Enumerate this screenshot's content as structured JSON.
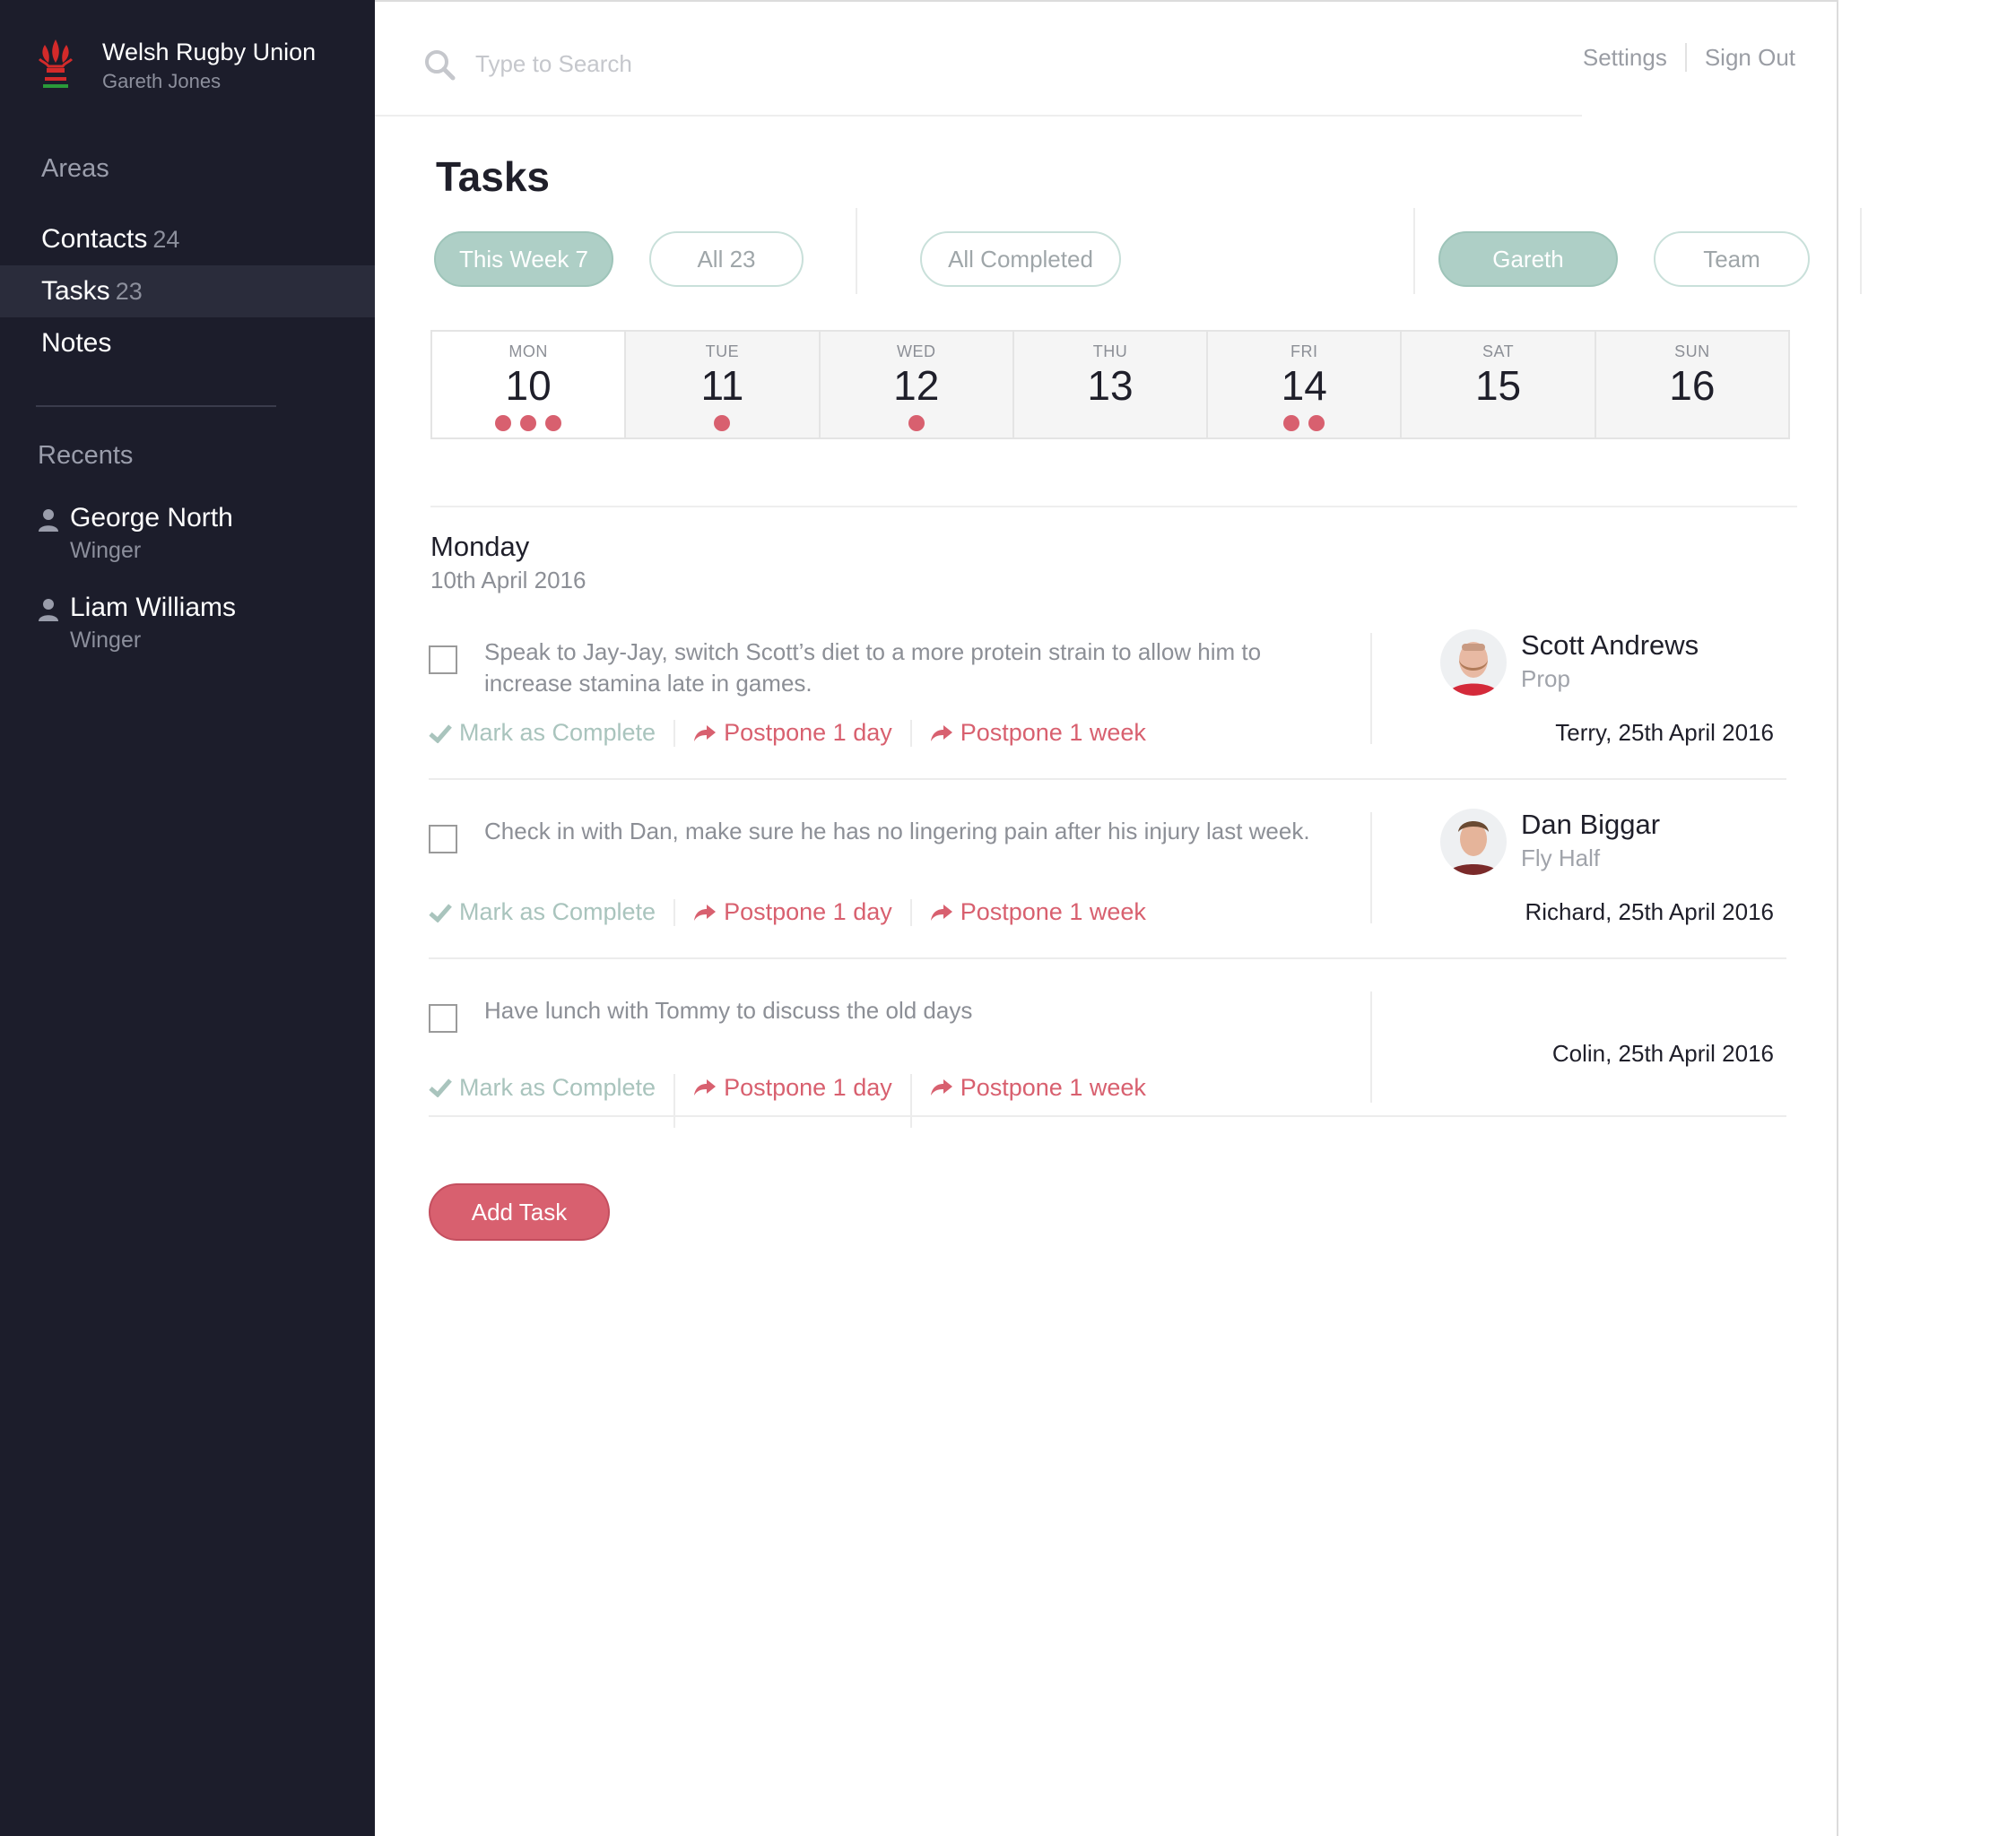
{
  "brand": {
    "title": "Welsh Rugby Union",
    "user": "Gareth Jones"
  },
  "sidebar": {
    "areas_heading": "Areas",
    "items": [
      {
        "label": "Contacts",
        "count": "24",
        "active": false
      },
      {
        "label": "Tasks",
        "count": "23",
        "active": true
      },
      {
        "label": "Notes",
        "count": "",
        "active": false
      }
    ],
    "recents_heading": "Recents",
    "recents": [
      {
        "name": "George North",
        "role": "Winger"
      },
      {
        "name": "Liam Williams",
        "role": "Winger"
      }
    ]
  },
  "header": {
    "search_placeholder": "Type to Search",
    "settings": "Settings",
    "sign_out": "Sign Out"
  },
  "page": {
    "title": "Tasks"
  },
  "filters": {
    "this_week": "This Week 7",
    "all": "All 23",
    "all_completed": "All Completed",
    "gareth": "Gareth",
    "team": "Team"
  },
  "week": [
    {
      "name": "MON",
      "num": "10",
      "dots": 3,
      "selected": true
    },
    {
      "name": "TUE",
      "num": "11",
      "dots": 1
    },
    {
      "name": "WED",
      "num": "12",
      "dots": 1
    },
    {
      "name": "THU",
      "num": "13",
      "dots": 0
    },
    {
      "name": "FRI",
      "num": "14",
      "dots": 2
    },
    {
      "name": "SAT",
      "num": "15",
      "dots": 0
    },
    {
      "name": "SUN",
      "num": "16",
      "dots": 0
    }
  ],
  "section": {
    "day": "Monday",
    "date": "10th April 2016"
  },
  "actions": {
    "complete": "Mark as Complete",
    "postpone_day": "Postpone 1 day",
    "postpone_week": "Postpone 1 week"
  },
  "tasks": [
    {
      "text": "Speak to Jay-Jay, switch Scott’s diet to a more protein strain to allow him to increase stamina late in games.",
      "person_name": "Scott Andrews",
      "person_role": "Prop",
      "assigned": "Terry, 25th April 2016"
    },
    {
      "text": "Check in with Dan, make sure he has no lingering pain after his injury last week.",
      "person_name": "Dan Biggar",
      "person_role": "Fly Half",
      "assigned": "Richard, 25th April 2016"
    },
    {
      "text": "Have lunch with Tommy to discuss the old days",
      "person_name": "",
      "person_role": "",
      "assigned": "Colin, 25th April 2016"
    }
  ],
  "add_task": "Add Task",
  "colors": {
    "sidebar": "#1c1d2b",
    "accent_red": "#d8606f",
    "accent_green": "#aecfc6"
  }
}
